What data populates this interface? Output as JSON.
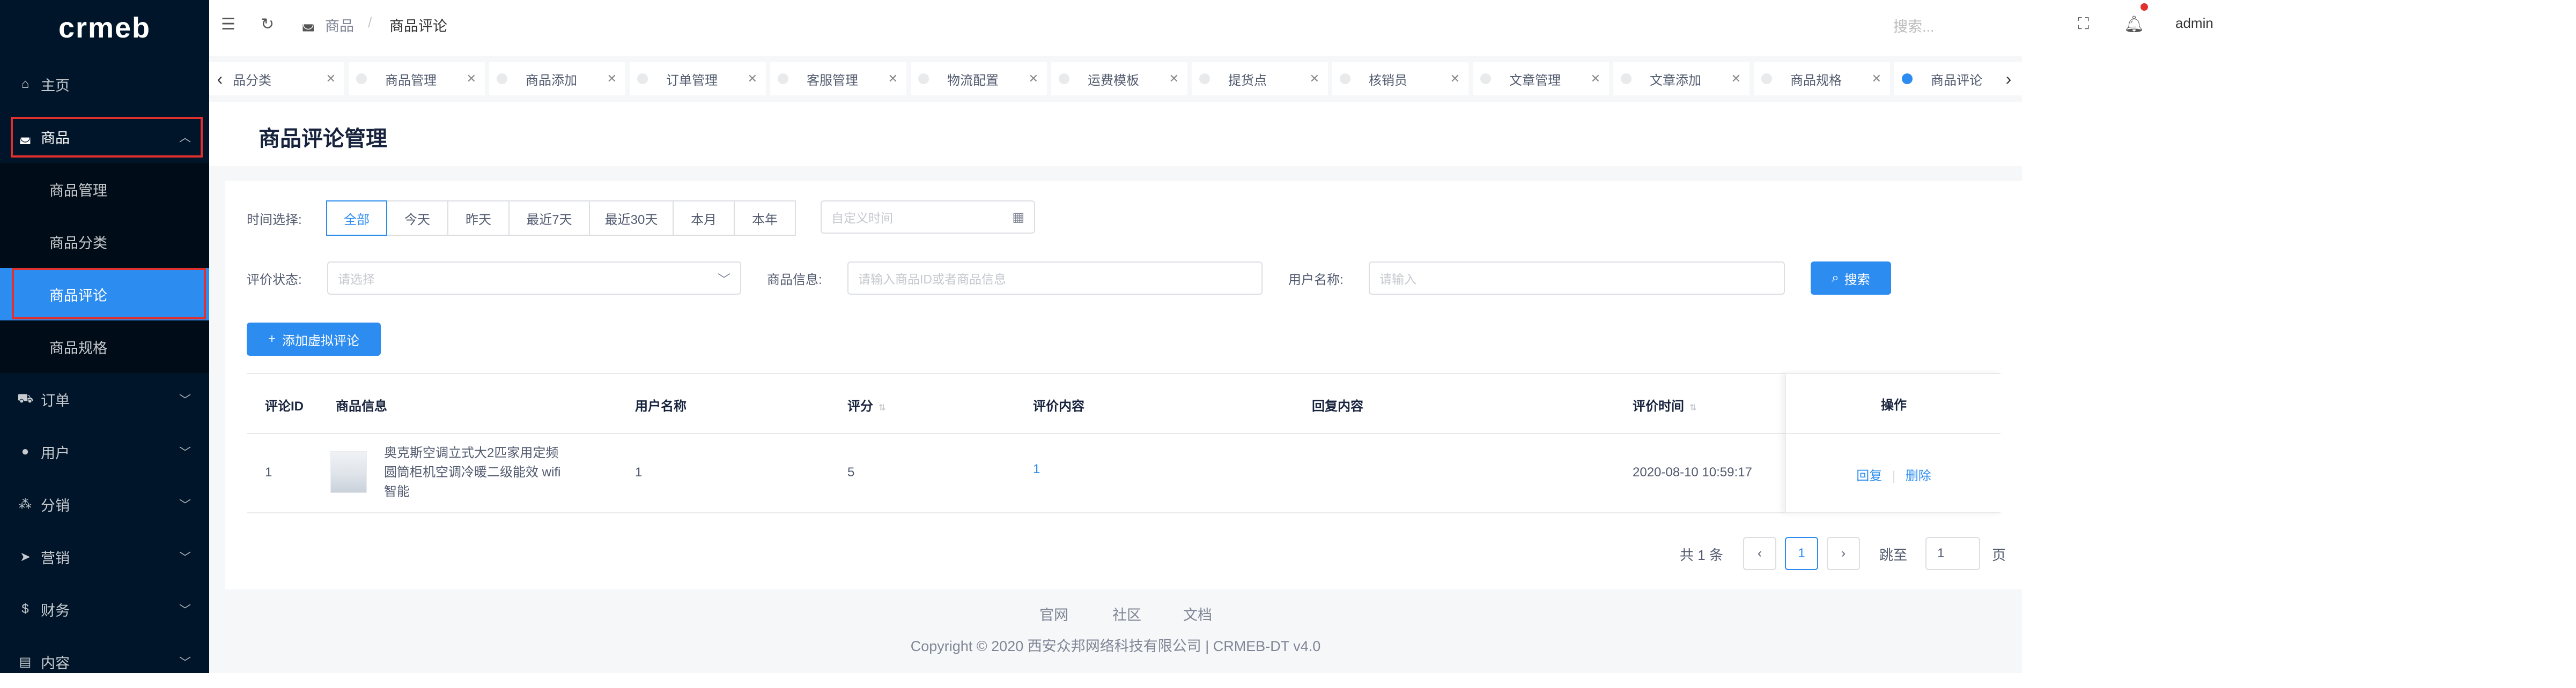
{
  "sidebar": {
    "logo": "crmeb",
    "menu": [
      {
        "icon": "home-icon",
        "glyph": "⌂",
        "label": "主页"
      },
      {
        "icon": "basket-icon",
        "glyph": "◛",
        "label": "商品"
      },
      {
        "icon": "cart-icon",
        "glyph": "⛟",
        "label": "订单"
      },
      {
        "icon": "user-icon",
        "glyph": "●",
        "label": "用户"
      },
      {
        "icon": "share-icon",
        "glyph": "⁂",
        "label": "分销"
      },
      {
        "icon": "send-icon",
        "glyph": "➤",
        "label": "营销"
      },
      {
        "icon": "dollar-icon",
        "glyph": "$",
        "label": "财务"
      },
      {
        "icon": "book-icon",
        "glyph": "▤",
        "label": "内容"
      }
    ],
    "submenu": [
      "商品管理",
      "商品分类",
      "商品评论",
      "商品规格"
    ],
    "active_sub": "商品评论",
    "callouts": [
      "1",
      "2"
    ]
  },
  "header": {
    "breadcrumb_root": "商品",
    "breadcrumb_sep": "/",
    "breadcrumb_current": "商品评论",
    "search_placeholder": "搜索...",
    "username": "admin"
  },
  "tabs": [
    {
      "label": "品分类",
      "active": false
    },
    {
      "label": "商品管理",
      "active": false
    },
    {
      "label": "商品添加",
      "active": false
    },
    {
      "label": "订单管理",
      "active": false
    },
    {
      "label": "客服管理",
      "active": false
    },
    {
      "label": "物流配置",
      "active": false
    },
    {
      "label": "运费模板",
      "active": false
    },
    {
      "label": "提货点",
      "active": false
    },
    {
      "label": "核销员",
      "active": false
    },
    {
      "label": "文章管理",
      "active": false
    },
    {
      "label": "文章添加",
      "active": false
    },
    {
      "label": "商品规格",
      "active": false
    },
    {
      "label": "商品评论",
      "active": true
    }
  ],
  "page": {
    "title": "商品评论管理"
  },
  "filters": {
    "time_label": "时间选择:",
    "time_options": [
      "全部",
      "今天",
      "昨天",
      "最近7天",
      "最近30天",
      "本月",
      "本年"
    ],
    "time_selected": "全部",
    "date_placeholder": "自定义时间",
    "status_label": "评价状态:",
    "status_placeholder": "请选择",
    "product_label": "商品信息:",
    "product_placeholder": "请输入商品ID或者商品信息",
    "user_label": "用户名称:",
    "user_placeholder": "请输入",
    "search_button": "搜索",
    "add_button": "添加虚拟评论"
  },
  "table": {
    "columns": [
      "评论ID",
      "商品信息",
      "用户名称",
      "评分",
      "评价内容",
      "回复内容",
      "评价时间",
      "操作"
    ],
    "rows": [
      {
        "id": "1",
        "product_line1": "奥克斯空调立式大2匹家用定频",
        "product_line2": "圆筒柜机空调冷暖二级能效 wifi",
        "product_line3": "智能",
        "user": "1",
        "score": "5",
        "content": "1",
        "reply": "",
        "time": "2020-08-10 10:59:17",
        "action_reply": "回复",
        "action_delete": "删除"
      }
    ]
  },
  "pagination": {
    "total_text": "共 1 条",
    "prev": "‹",
    "current": "1",
    "next": "›",
    "jump_label": "跳至",
    "jump_value": "1",
    "page_suffix": "页"
  },
  "footer": {
    "links": [
      "官网",
      "社区",
      "文档"
    ],
    "copyright": "Copyright © 2020 西安众邦网络科技有限公司 | CRMEB-DT v4.0"
  },
  "colors": {
    "sidebar_bg": "#001529",
    "primary": "#2d8cf0",
    "highlight_red": "#e0312f"
  }
}
